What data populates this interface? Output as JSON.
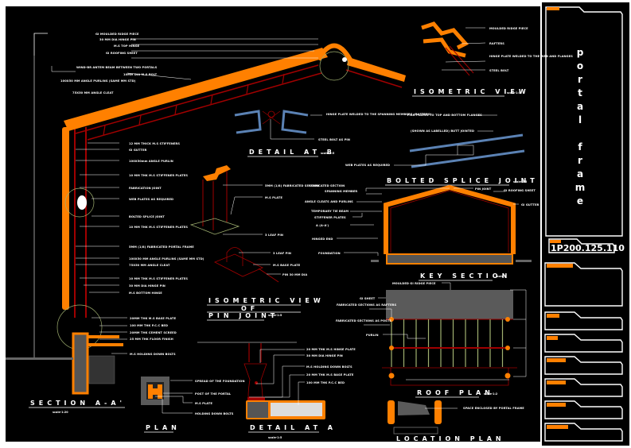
{
  "sheet": {
    "title_vertical": [
      "p",
      "o",
      "r",
      "t",
      "a",
      "l",
      "",
      "f",
      "r",
      "a",
      "m",
      "e"
    ],
    "drawing_number": "1P200.125.110",
    "colors": {
      "background": "#000000",
      "frame": "#ffffff",
      "accent_orange": "#ff8000",
      "steel_red": "#a00000",
      "blue_member": "#5b82b4",
      "green_line": "#a0b070",
      "grey_fill": "#5a5a5a"
    },
    "titleblock_rows": 7
  },
  "section_aa": {
    "title": "SECTION    A-A'",
    "scale": "scale-1:20",
    "labels": [
      "GI MOULDED RIDGE PIECE",
      "30 MM DIA HINGE PIN",
      "M.S TOP HINGE",
      "GI ROOFING SHEET",
      "WIND-BR ANTEM BEAM BETWEEN TWO PORTALS",
      "10MM DIA M.S BOLT",
      "100X50 MM ANGLE PURLINS (SAME MM STD)",
      "75X50 MM ANGLE CLEAT",
      "12 MM THICK M.S STIFFENERS",
      "GI GUTTER",
      "100X50mm ANGLE PURLIN",
      "10 MM THK M.S STIFFENER PLATES",
      "FABRICATION JOINT",
      "WEB PLATES AS REQUIRED",
      "BOLTED SPLICE JOINT",
      "10 MM THK M.S STIFFENER PLATES",
      "5MM (1/8) FABRICATED PORTAL FRAME",
      "100X50 MM ANGLE PURLINS (SAME MM STD)",
      "75X50 MM ANGLE CLEAT",
      "10 MM THK M.S STIFFENER PLATES",
      "30 MM DIA HINGE PIN",
      "M.S BOTTOM HINGE",
      "20MM THK M.S BASE PLATE",
      "100 MM THK P.C.C BED",
      "20MM THK CEMENT SCREED",
      "25 MM THK FLOOR FINISH",
      "M.S HOLDING DOWN BOLTS"
    ]
  },
  "isometric_ridge": {
    "title": "ISOMETRIC  VIEW",
    "scale": "scale-1:5",
    "labels": [
      "MOULDED RIDGE PIECE",
      "RAFTERS",
      "HINGE PLATE WELDED TO THE WEB AND FLANGES",
      "STEEL BOLT"
    ]
  },
  "detail_b": {
    "title": "DETAIL  AT  B",
    "scale": "scale-1:5",
    "labels": [
      "HINGE PLATE WELDED TO THE SPANNING MEMBERS (RAFTERS)",
      "STEEL BOLT AS PIN"
    ]
  },
  "bolted_splice": {
    "title": "BOLTED  SPLICE  JOINT",
    "scale": "scale-1:5",
    "labels": [
      "FISH PLATES TO TOP AND BOTTOM FLANGES",
      "(SHOWN AS LABELLED) BUTT JOINTED",
      "WEB PLATES AS REQUIRED"
    ]
  },
  "column_iso": {
    "labels": [
      "5MM (1/8) FABRICATED SECTION",
      "M.S PLATE",
      "3 LEAF PIN"
    ]
  },
  "pin_joint": {
    "title_lines": [
      "ISOMETRIC  VIEW",
      "OF",
      "PIN  JOINT"
    ],
    "scale": "scale-1:5",
    "labels": [
      "3 LEAF PIN",
      "M.S BASE PLATE",
      "PIN 30 MM DIA"
    ]
  },
  "key_section": {
    "title": "KEY  SECTION",
    "scale": "scale-1",
    "labels_left": [
      "FABRICATED SECTION",
      "SPANNING MEMBER",
      "ANGLE CLEATS AND PURLINS",
      "TEMPORARY TIE BEAM",
      "STIFFENER PLATES",
      "A  (A-A')",
      "HINGED END",
      "FOUNDATION"
    ],
    "labels_right": [
      "PIN JOINT",
      "GI ROOFING SHEET",
      "GI GUTTER"
    ]
  },
  "roof_plan": {
    "title": "ROOF  PLAN",
    "scale": "scale-1:2",
    "labels": [
      "MOULDED GI RIDGE PIECE",
      "GI SHEET",
      "FABRICATED SECTIONS AS RAFTERS",
      "FABRICATED SECTIONS AS POSTS",
      "PURLIN"
    ]
  },
  "plan": {
    "title": "PLAN",
    "labels": [
      "SPREAD OF THE FOUNDATION",
      "POST OF THE PORTAL",
      "M.S PLATE",
      "HOLDING DOWN BOLTS"
    ]
  },
  "detail_a": {
    "title": "DETAIL  AT  A",
    "scale": "scale-1:5",
    "labels": [
      "20 MM THK M.S HINGE PLATE",
      "30 MM DIA HINGE PIN",
      "M.S HOLDING DOWN BOLTS",
      "20 MM THK M.S BASE PLATE",
      "100 MM THK P.C.C BED"
    ]
  },
  "location_plan": {
    "title": "LOCATION    PLAN",
    "labels": [
      "SPACE ENCLOSED BY PORTAL FRAME"
    ]
  }
}
